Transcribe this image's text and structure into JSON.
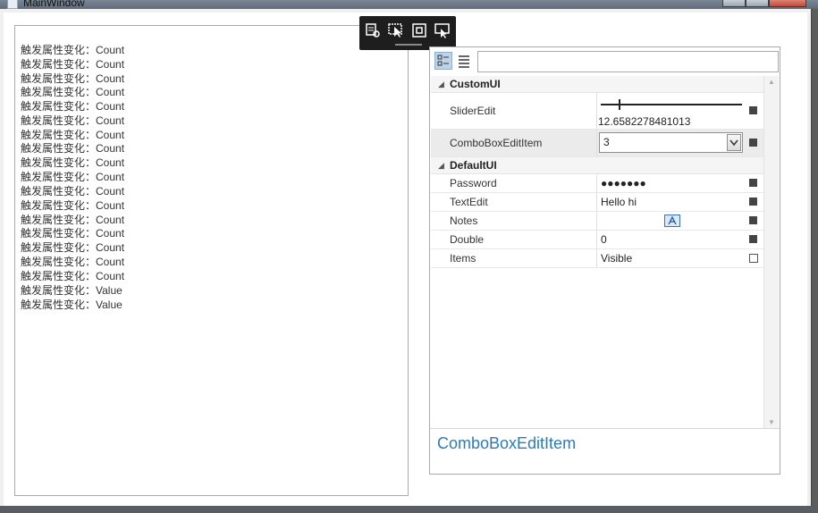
{
  "window": {
    "title": "MainWindow"
  },
  "log": {
    "lines": [
      "触发属性变化：Count",
      "触发属性变化：Count",
      "触发属性变化：Count",
      "触发属性变化：Count",
      "触发属性变化：Count",
      "触发属性变化：Count",
      "触发属性变化：Count",
      "触发属性变化：Count",
      "触发属性变化：Count",
      "触发属性变化：Count",
      "触发属性变化：Count",
      "触发属性变化：Count",
      "触发属性变化：Count",
      "触发属性变化：Count",
      "触发属性变化：Count",
      "触发属性变化：Count",
      "触发属性变化：Count",
      "触发属性变化：Value",
      "触发属性变化：Value"
    ]
  },
  "property_grid": {
    "search": {
      "value": ""
    },
    "categories": [
      {
        "name": "CustomUI",
        "properties": [
          {
            "label": "SliderEdit",
            "value": "12.6582278481013",
            "slider_fraction": 0.127
          },
          {
            "label": "ComboBoxEditItem",
            "value": "3"
          }
        ]
      },
      {
        "name": "DefaultUI",
        "properties": [
          {
            "label": "Password",
            "value": "●●●●●●●"
          },
          {
            "label": "TextEdit",
            "value": "Hello hi"
          },
          {
            "label": "Notes",
            "value": ""
          },
          {
            "label": "Double",
            "value": "0"
          },
          {
            "label": "Items",
            "value": "Visible"
          }
        ]
      }
    ],
    "description": {
      "name": "ComboBoxEditItem"
    }
  },
  "colors": {
    "accent": "#2b7bb9",
    "devtools_bg": "#1e1e1e"
  }
}
